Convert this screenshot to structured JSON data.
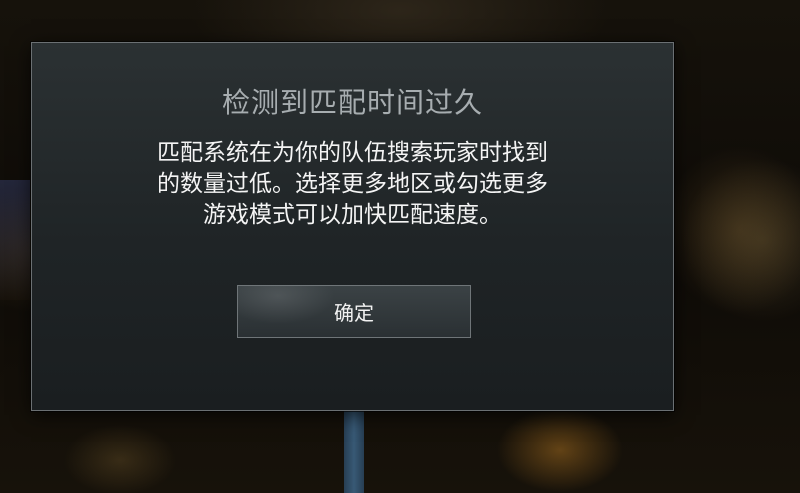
{
  "dialog": {
    "title": "检测到匹配时间过久",
    "message": "匹配系统在为你的队伍搜索玩家时找到\n的数量过低。选择更多地区或勾选更多\n游戏模式可以加快匹配速度。",
    "confirm_label": "确定"
  },
  "colors": {
    "dialog_bg": "#22282a",
    "dialog_border": "#6b7073",
    "title_text": "#a7adb0",
    "message_text": "#f4f4f4",
    "button_bg": "#333a3d"
  }
}
